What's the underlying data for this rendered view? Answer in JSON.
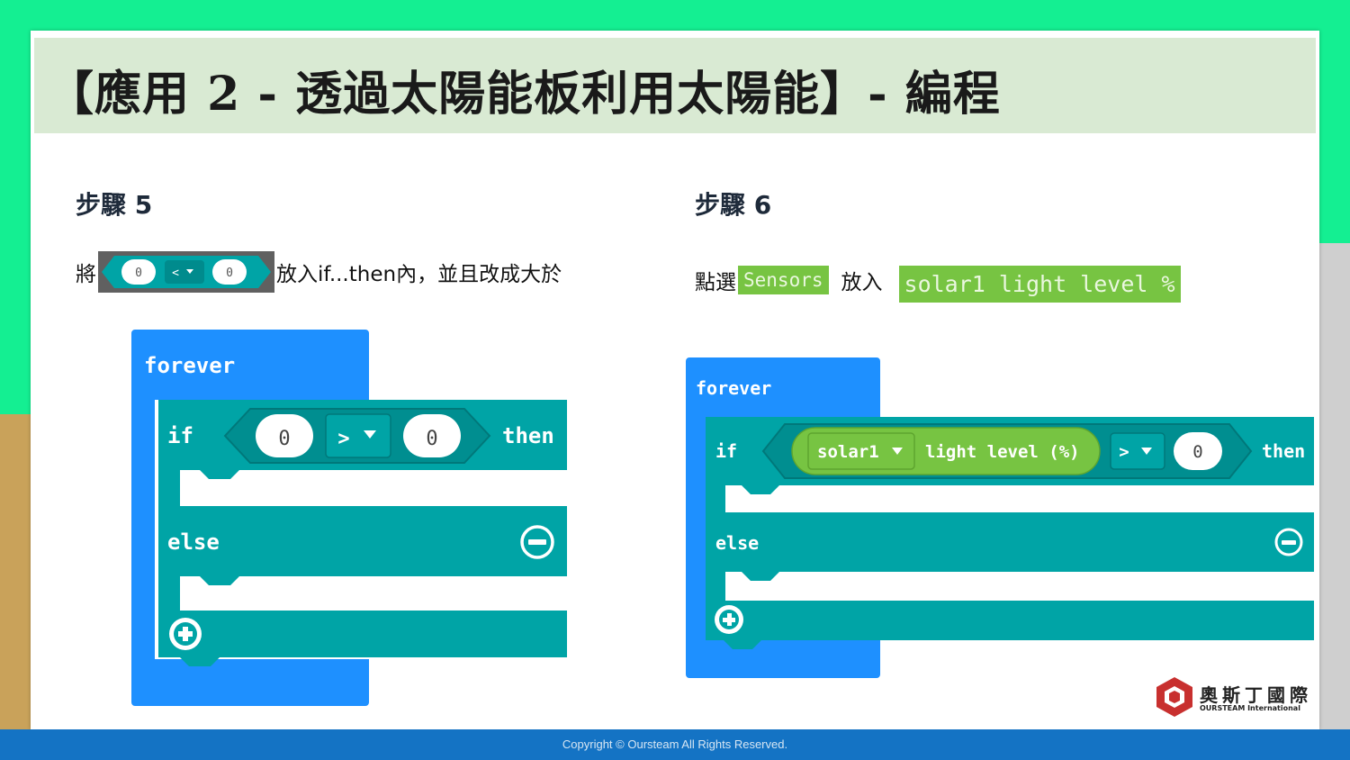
{
  "title": "【應用 2 - 透過太陽能板利用太陽能】- 編程",
  "step5": {
    "heading": "步驟 5",
    "prefix": "將",
    "suffix": "放入if...then內，並且改成大於",
    "mini_left": "0",
    "mini_op": "<",
    "mini_right": "0",
    "block": {
      "forever": "forever",
      "if": "if",
      "left_value": "0",
      "operator": ">",
      "right_value": "0",
      "then": "then",
      "else": "else"
    }
  },
  "step6": {
    "heading": "步驟 6",
    "prefix": "點選",
    "category": "Sensors",
    "mid": "放入",
    "sensor_block": "solar1 light level %",
    "block": {
      "forever": "forever",
      "if": "if",
      "sensor_dropdown": "solar1",
      "sensor_label": "light level (%)",
      "operator": ">",
      "right_value": "0",
      "then": "then",
      "else": "else"
    }
  },
  "logo": {
    "name": "奧斯丁國際",
    "sub": "OURSTEAM International"
  },
  "footer": "Copyright © Oursteam All Rights Reserved.",
  "colors": {
    "loop_blue": "#1e90ff",
    "logic_teal": "#00a4a6",
    "sensor_green": "#77c442",
    "footer_blue": "#1473c4"
  }
}
